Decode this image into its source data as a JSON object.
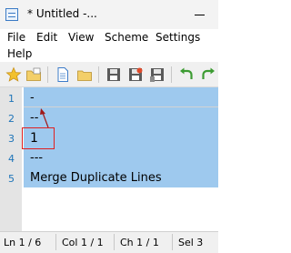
{
  "window": {
    "title": "* Untitled -..."
  },
  "menu": {
    "file": "File",
    "edit": "Edit",
    "view": "View",
    "scheme": "Scheme",
    "settings": "Settings",
    "help": "Help"
  },
  "toolbar": {
    "icons": [
      "favorites-star-icon",
      "open-folder-icon",
      "new-file-icon",
      "open-file-icon",
      "save-icon",
      "save-as-icon",
      "save-copy-icon",
      "undo-icon",
      "redo-icon"
    ]
  },
  "editor": {
    "line_numbers": [
      "1",
      "2",
      "3",
      "4",
      "5"
    ],
    "lines": [
      "-",
      "--",
      "1",
      "---",
      "Merge Duplicate Lines"
    ],
    "colors": {
      "selection": "#9ec9ee",
      "gutter": "#e4e4e4",
      "line_number": "#1e74b8",
      "annotation": "#e02020"
    }
  },
  "status": {
    "line": "Ln 1 / 6",
    "col": "Col 1 / 1",
    "ch": "Ch 1 / 1",
    "sel": "Sel 3"
  }
}
